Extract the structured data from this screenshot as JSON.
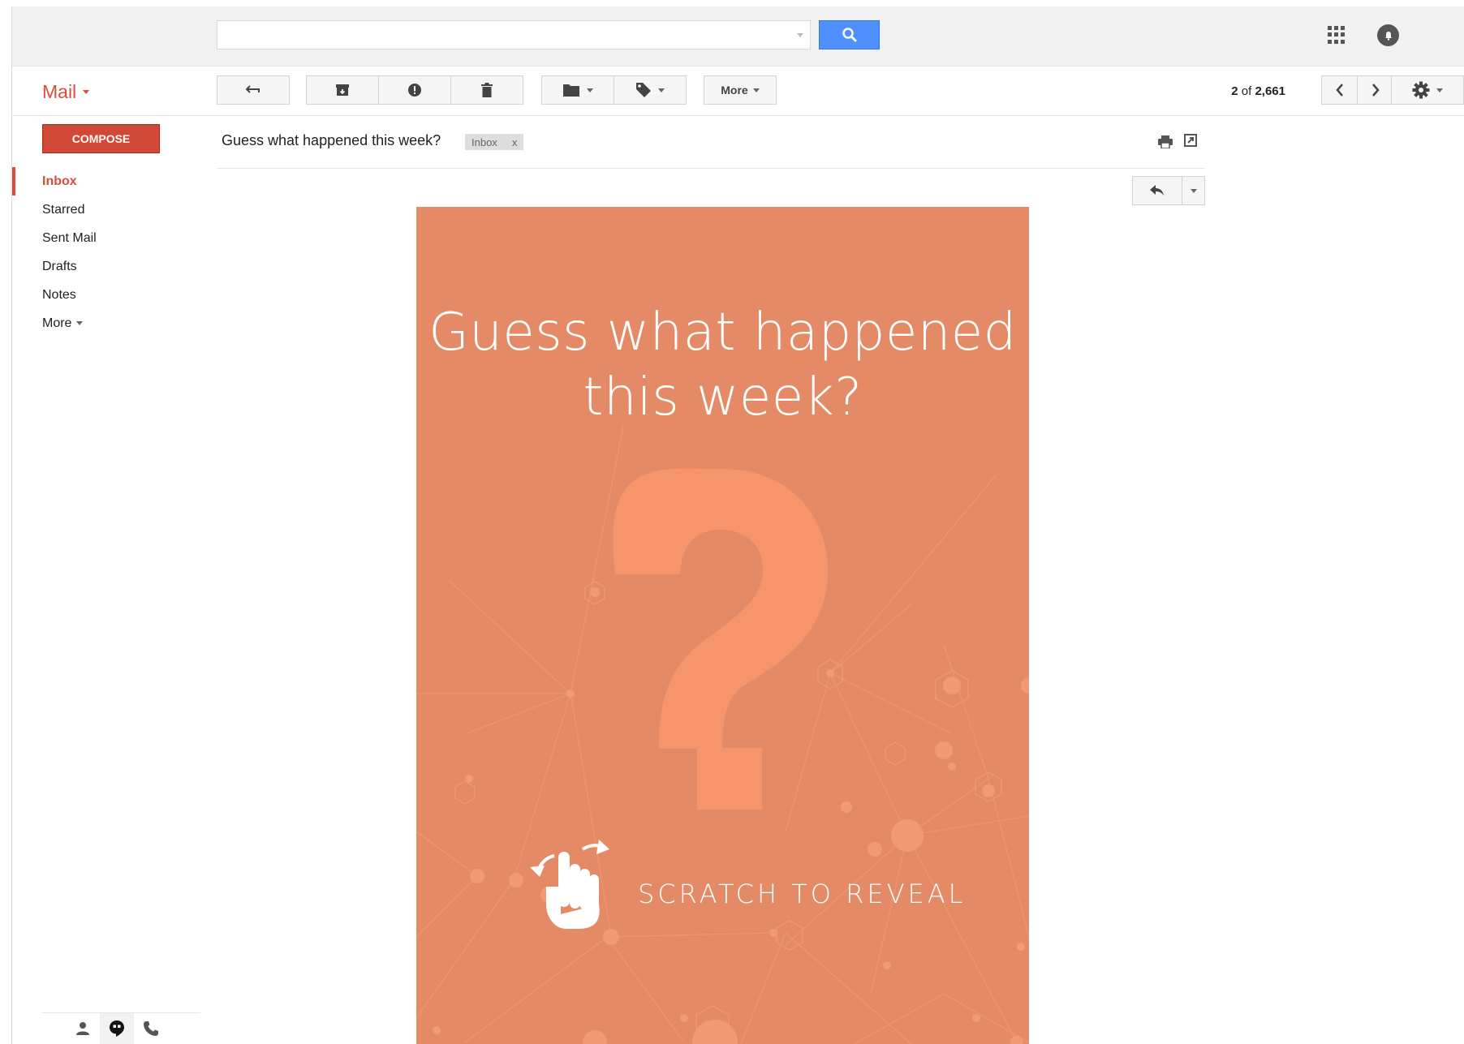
{
  "search": {
    "value": "",
    "placeholder": ""
  },
  "app": {
    "mail_label": "Mail"
  },
  "toolbar": {
    "more_label": "More"
  },
  "pagination": {
    "current": "2",
    "of": "of",
    "total": "2,661"
  },
  "compose": {
    "label": "COMPOSE"
  },
  "sidebar": {
    "items": [
      {
        "label": "Inbox",
        "active": true
      },
      {
        "label": "Starred"
      },
      {
        "label": "Sent Mail"
      },
      {
        "label": "Drafts"
      },
      {
        "label": "Notes"
      },
      {
        "label": "More"
      }
    ]
  },
  "message": {
    "subject": "Guess what happened this week?",
    "label_chip": "Inbox",
    "label_remove": "x"
  },
  "card": {
    "title_line1": "Guess what happened",
    "title_line2": "this week?",
    "reveal_text": "SCRATCH TO REVEAL"
  },
  "colors": {
    "accent_red": "#dd4b39",
    "compose_red": "#d14836",
    "search_blue": "#4d90fe",
    "card_bg": "#e48a66",
    "card_accent": "#f6956b"
  }
}
